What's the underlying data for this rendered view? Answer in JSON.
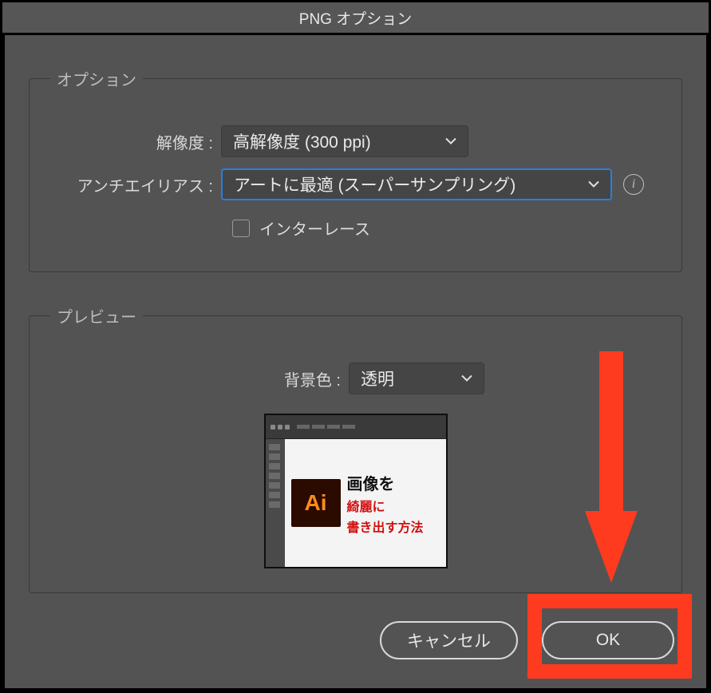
{
  "window": {
    "title": "PNG オプション"
  },
  "options": {
    "legend": "オプション",
    "resolution_label": "解像度 :",
    "resolution_value": "高解像度 (300 ppi)",
    "antialias_label": "アンチエイリアス :",
    "antialias_value": "アートに最適 (スーパーサンプリング)",
    "interlace_label": "インターレース"
  },
  "preview": {
    "legend": "プレビュー",
    "bgcolor_label": "背景色 :",
    "bgcolor_value": "透明",
    "thumb": {
      "ai": "Ai",
      "line1": "画像を",
      "line2": "綺麗に",
      "line3": "書き出す方法"
    }
  },
  "buttons": {
    "cancel": "キャンセル",
    "ok": "OK"
  },
  "annotation": {
    "arrow_color": "#ff3b1f"
  }
}
